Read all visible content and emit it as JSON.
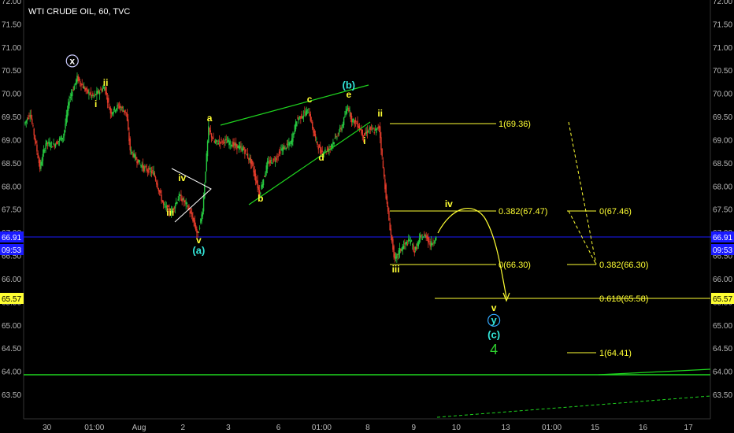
{
  "header": {
    "title": "WTI CRUDE OIL, 60, TVC"
  },
  "colors": {
    "background": "#000000",
    "up": "#26c940",
    "down": "#e23b2a",
    "wave_primary": "#ffff33",
    "wave_cyan": "#33e6d9",
    "wave_white": "#ffffff",
    "trendline": "#1fd51f",
    "price_line": "#1a1aff",
    "fib": "#ffff33"
  },
  "badges": {
    "current_price": "66.91",
    "countdown": "09:53",
    "fib_level": "65.57"
  },
  "chart_data": {
    "type": "candlestick",
    "title": "WTI CRUDE OIL, 60, TVC",
    "ylim": [
      63.2,
      72.1
    ],
    "y_ticks": [
      "63.50",
      "64.00",
      "64.50",
      "65.00",
      "65.50",
      "66.00",
      "66.50",
      "67.00",
      "67.50",
      "68.00",
      "68.50",
      "69.00",
      "69.50",
      "70.00",
      "70.50",
      "71.00",
      "71.50",
      "72.00"
    ],
    "x_ticks": [
      "30",
      "01:00",
      "Aug",
      "2",
      "3",
      "6",
      "01:00",
      "8",
      "9",
      "10",
      "13",
      "01:00",
      "15",
      "16",
      "17"
    ],
    "current_price": 66.91,
    "price_path": [
      [
        0,
        69.35
      ],
      [
        6,
        69.6
      ],
      [
        12,
        68.9
      ],
      [
        16,
        68.4
      ],
      [
        22,
        68.95
      ],
      [
        30,
        68.9
      ],
      [
        40,
        69.1
      ],
      [
        46,
        69.9
      ],
      [
        54,
        70.35
      ],
      [
        62,
        70.1
      ],
      [
        70,
        69.95
      ],
      [
        82,
        70.15
      ],
      [
        88,
        69.6
      ],
      [
        96,
        69.75
      ],
      [
        104,
        69.6
      ],
      [
        108,
        68.8
      ],
      [
        114,
        68.6
      ],
      [
        122,
        68.4
      ],
      [
        132,
        68.3
      ],
      [
        142,
        67.6
      ],
      [
        150,
        67.45
      ],
      [
        158,
        67.8
      ],
      [
        166,
        67.6
      ],
      [
        172,
        67.3
      ],
      [
        177,
        66.95
      ],
      [
        182,
        67.5
      ],
      [
        188,
        69.25
      ],
      [
        194,
        68.95
      ],
      [
        204,
        69.0
      ],
      [
        214,
        68.9
      ],
      [
        224,
        68.8
      ],
      [
        232,
        68.5
      ],
      [
        240,
        67.85
      ],
      [
        248,
        68.5
      ],
      [
        256,
        68.6
      ],
      [
        262,
        68.8
      ],
      [
        272,
        68.95
      ],
      [
        278,
        69.45
      ],
      [
        284,
        69.55
      ],
      [
        290,
        69.65
      ],
      [
        296,
        69.1
      ],
      [
        302,
        68.75
      ],
      [
        310,
        68.8
      ],
      [
        316,
        69.0
      ],
      [
        324,
        69.3
      ],
      [
        330,
        69.75
      ],
      [
        334,
        69.45
      ],
      [
        340,
        69.35
      ],
      [
        346,
        69.1
      ],
      [
        352,
        69.25
      ],
      [
        358,
        69.2
      ],
      [
        362,
        69.3
      ],
      [
        366,
        68.4
      ],
      [
        370,
        67.6
      ],
      [
        374,
        66.95
      ],
      [
        378,
        66.4
      ],
      [
        382,
        66.6
      ],
      [
        388,
        66.75
      ],
      [
        394,
        66.85
      ],
      [
        398,
        66.6
      ],
      [
        404,
        66.9
      ],
      [
        410,
        66.95
      ],
      [
        414,
        66.75
      ],
      [
        420,
        66.9
      ]
    ],
    "waves": [
      {
        "label": "x",
        "circled": true,
        "time": 48,
        "price": 70.65,
        "color": "white"
      },
      {
        "label": "i",
        "time": 72,
        "price": 69.72,
        "color": "yellow"
      },
      {
        "label": "ii",
        "time": 82,
        "price": 70.18,
        "color": "yellow"
      },
      {
        "label": "iii",
        "time": 148,
        "price": 67.38,
        "color": "yellow"
      },
      {
        "label": "iv",
        "time": 160,
        "price": 68.12,
        "color": "yellow"
      },
      {
        "label": "v",
        "time": 177,
        "price": 66.78,
        "color": "yellow"
      },
      {
        "label": "(a)",
        "time": 177,
        "price": 66.55,
        "color": "cyan"
      },
      {
        "label": "a",
        "time": 188,
        "price": 69.42,
        "color": "yellow"
      },
      {
        "label": "b",
        "time": 240,
        "price": 67.68,
        "color": "yellow"
      },
      {
        "label": "c",
        "time": 290,
        "price": 69.82,
        "color": "yellow"
      },
      {
        "label": "d",
        "time": 302,
        "price": 68.57,
        "color": "yellow"
      },
      {
        "label": "e",
        "time": 330,
        "price": 69.93,
        "color": "yellow"
      },
      {
        "label": "(b)",
        "time": 330,
        "price": 70.12,
        "color": "cyan"
      },
      {
        "label": "i",
        "time": 346,
        "price": 68.92,
        "color": "yellow"
      },
      {
        "label": "ii",
        "time": 362,
        "price": 69.52,
        "color": "yellow"
      },
      {
        "label": "iii",
        "time": 378,
        "price": 66.15,
        "color": "yellow"
      },
      {
        "label": "iv",
        "time": 432,
        "price": 67.56,
        "color": "yellow"
      },
      {
        "label": "v",
        "time": 478,
        "price": 65.32,
        "color": "yellow"
      },
      {
        "label": "y",
        "circled": true,
        "time": 478,
        "price": 65.05,
        "color": "cyan"
      },
      {
        "label": "(c)",
        "time": 478,
        "price": 64.73,
        "color": "cyan"
      },
      {
        "label": "4",
        "time": 478,
        "price": 64.38,
        "color": "green"
      }
    ],
    "fib_levels": [
      {
        "label": "1(69.36)",
        "price": 69.36
      },
      {
        "label": "0.382(67.47)",
        "price": 67.47
      },
      {
        "label": "0(66.30)",
        "price": 66.3
      },
      {
        "label": "0(67.46)",
        "price": 67.46
      },
      {
        "label": "0.382(66.30)",
        "price": 66.3
      },
      {
        "label": "0.618(65.58)",
        "price": 65.58
      },
      {
        "label": "1(64.41)",
        "price": 64.41
      }
    ],
    "support_line": 63.95
  }
}
